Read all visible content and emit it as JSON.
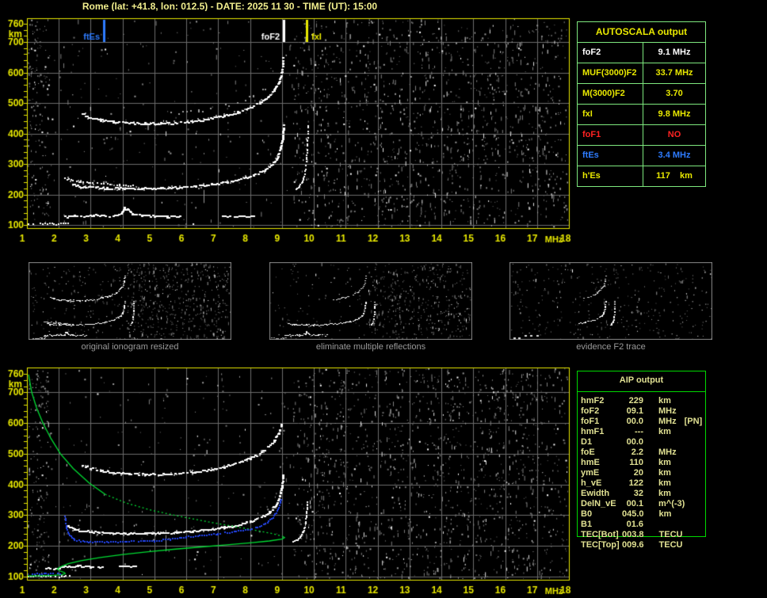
{
  "title": "Rome (lat: +41.8, lon: 012.5) - DATE: 2025 11 30 - TIME (UT): 15:00",
  "colors": {
    "accent_yellow": "#e8e800",
    "title_yellow": "#f2ef8e",
    "grid_gray": "#6c6c6c",
    "trace_white": "#ffffff",
    "trace_gray": "#9a9a9a",
    "profile_green": "#00dd33",
    "scaled_trace_blue": "#2244ee",
    "marker_blue": "#2e7cff",
    "table_border_light_green": "#7ee87e",
    "table_border_green": "#00d800",
    "aip_text": "#e0e092",
    "caption_gray": "#9a9a9a",
    "alert_red": "#ff2222"
  },
  "autoscala_table": {
    "title": "AUTOSCALA output",
    "rows": [
      {
        "label": "foF2",
        "value": "9.1 MHz",
        "color": "#ffffff"
      },
      {
        "label": "MUF(3000)F2",
        "value": "33.7 MHz",
        "color": "#e8e800"
      },
      {
        "label": "M(3000)F2",
        "value": "3.70",
        "color": "#e8e800"
      },
      {
        "label": "fxI",
        "value": "9.8 MHz",
        "color": "#e8e800"
      },
      {
        "label": "foF1",
        "value": "NO",
        "color": "#ff2222"
      },
      {
        "label": "ftEs",
        "value": "3.4 MHz",
        "color": "#2e7cff"
      },
      {
        "label": "h'Es",
        "value": "117    km",
        "color": "#e8e800"
      }
    ]
  },
  "aip_table": {
    "title": "AIP output",
    "rows": [
      {
        "label": "hmF2",
        "value": "229",
        "unit": "km",
        "note": ""
      },
      {
        "label": "foF2",
        "value": "09.1",
        "unit": "MHz",
        "note": ""
      },
      {
        "label": "foF1",
        "value": "00.0",
        "unit": "MHz",
        "note": "[PN]"
      },
      {
        "label": "hmF1",
        "value": "---",
        "unit": "km",
        "note": ""
      },
      {
        "label": "D1",
        "value": "00.0",
        "unit": "",
        "note": ""
      },
      {
        "label": "foE",
        "value": "2.2",
        "unit": "MHz",
        "note": ""
      },
      {
        "label": "hmE",
        "value": "110",
        "unit": "km",
        "note": ""
      },
      {
        "label": "ymE",
        "value": "20",
        "unit": "km",
        "note": ""
      },
      {
        "label": "h_vE",
        "value": "122",
        "unit": "km",
        "note": ""
      },
      {
        "label": "Ewidth",
        "value": "32",
        "unit": "km",
        "note": ""
      },
      {
        "label": "DelN_vE",
        "value": "00.1",
        "unit": "m^(-3)",
        "note": ""
      },
      {
        "label": "B0",
        "value": "045.0",
        "unit": "km",
        "note": ""
      },
      {
        "label": "B1",
        "value": "01.6",
        "unit": "",
        "note": ""
      },
      {
        "label": "TEC[Bot]",
        "value": "003.8",
        "unit": "TECU",
        "note": ""
      },
      {
        "label": "TEC[Top]",
        "value": "009.6",
        "unit": "TECU",
        "note": ""
      }
    ]
  },
  "thumbnails": [
    {
      "caption": "original ionogram resized"
    },
    {
      "caption": "eliminate multiple reflections"
    },
    {
      "caption": "evidence F2 trace"
    }
  ],
  "chart_data": {
    "type": "scatter",
    "xlabel": "MHz",
    "ylabel": "km",
    "xlim": [
      1,
      18
    ],
    "ylim": [
      100,
      760
    ],
    "grid": true,
    "x_ticks": [
      1,
      2,
      3,
      4,
      5,
      6,
      7,
      8,
      9,
      10,
      11,
      12,
      13,
      14,
      15,
      16,
      17,
      18
    ],
    "y_ticks": [
      760,
      700,
      600,
      500,
      400,
      300,
      200,
      100
    ],
    "top_plot": {
      "markers": [
        {
          "name": "ftEs",
          "freq": 3.4,
          "color": "#2e7cff",
          "label_side": "left"
        },
        {
          "name": "foF2",
          "freq": 9.05,
          "color": "#ffffff",
          "label_side": "left"
        },
        {
          "name": "fxI",
          "freq": 9.78,
          "color": "#e8e800",
          "label_side": "right"
        }
      ],
      "traces": {
        "f2_upper": [
          [
            2.2,
            252
          ],
          [
            2.45,
            246
          ],
          [
            2.7,
            241
          ],
          [
            3.0,
            237
          ],
          [
            3.4,
            234
          ],
          [
            3.9,
            231
          ],
          [
            4.4,
            229
          ]
        ],
        "f2_main": [
          [
            2.45,
            230
          ],
          [
            2.7,
            225
          ],
          [
            3.0,
            222
          ],
          [
            3.5,
            220
          ],
          [
            4.0,
            219
          ],
          [
            4.6,
            219
          ],
          [
            5.2,
            220
          ],
          [
            5.8,
            222
          ],
          [
            6.3,
            226
          ],
          [
            6.8,
            232
          ],
          [
            7.3,
            240
          ],
          [
            7.7,
            250
          ],
          [
            8.1,
            263
          ],
          [
            8.45,
            279
          ],
          [
            8.7,
            298
          ],
          [
            8.85,
            320
          ],
          [
            8.95,
            348
          ],
          [
            9.02,
            382
          ],
          [
            9.05,
            425
          ]
        ],
        "hop2": [
          [
            2.75,
            462
          ],
          [
            3.0,
            452
          ],
          [
            3.3,
            444
          ],
          [
            3.7,
            438
          ],
          [
            4.2,
            434
          ],
          [
            4.7,
            432
          ],
          [
            5.2,
            432
          ],
          [
            5.7,
            434
          ],
          [
            6.2,
            439
          ],
          [
            6.7,
            446
          ],
          [
            7.2,
            457
          ],
          [
            7.6,
            469
          ],
          [
            8.0,
            484
          ],
          [
            8.3,
            500
          ],
          [
            8.55,
            519
          ],
          [
            8.75,
            541
          ],
          [
            8.9,
            566
          ],
          [
            9.0,
            602
          ],
          [
            9.04,
            645
          ]
        ],
        "hop2_upper_dots": [
          [
            5.4,
            464
          ],
          [
            5.9,
            468
          ],
          [
            6.4,
            474
          ],
          [
            6.9,
            483
          ],
          [
            7.35,
            494
          ],
          [
            7.75,
            508
          ],
          [
            8.1,
            524
          ],
          [
            8.4,
            543
          ],
          [
            8.65,
            562
          ]
        ],
        "es": [
          [
            2.2,
            126
          ],
          [
            2.5,
            129
          ],
          [
            2.8,
            127
          ],
          [
            3.1,
            131
          ],
          [
            3.4,
            128
          ],
          [
            3.7,
            130
          ],
          [
            3.95,
            136
          ],
          [
            4.05,
            155
          ],
          [
            4.15,
            150
          ],
          [
            4.3,
            136
          ],
          [
            4.6,
            130
          ],
          [
            5.0,
            128
          ],
          [
            5.4,
            127
          ],
          [
            5.8,
            127
          ]
        ],
        "es_dash": [
          [
            7.15,
            128
          ],
          [
            8.1,
            128
          ]
        ],
        "es_low": [
          [
            1.05,
            104
          ],
          [
            1.5,
            103
          ],
          [
            2.0,
            103
          ],
          [
            2.3,
            105
          ]
        ],
        "xmode": [
          [
            9.45,
            215
          ],
          [
            9.55,
            225
          ],
          [
            9.65,
            242
          ],
          [
            9.72,
            265
          ],
          [
            9.76,
            295
          ],
          [
            9.79,
            335
          ],
          [
            9.81,
            380
          ],
          [
            9.82,
            425
          ]
        ],
        "spur": {
          "freq": 6.55,
          "h_from": 215,
          "h_to": 172
        }
      }
    },
    "bottom_plot": {
      "traces": {
        "f2_main": [
          [
            2.3,
            264
          ],
          [
            2.5,
            253
          ],
          [
            2.8,
            247
          ],
          [
            3.2,
            243
          ],
          [
            3.7,
            241
          ],
          [
            4.2,
            240
          ],
          [
            4.7,
            240
          ],
          [
            5.2,
            241
          ],
          [
            5.7,
            243
          ],
          [
            6.2,
            247
          ],
          [
            6.7,
            252
          ],
          [
            7.2,
            259
          ],
          [
            7.6,
            267
          ],
          [
            8.0,
            278
          ],
          [
            8.35,
            292
          ],
          [
            8.6,
            308
          ],
          [
            8.8,
            331
          ],
          [
            8.92,
            358
          ],
          [
            9.0,
            392
          ],
          [
            9.04,
            428
          ]
        ],
        "hop2": [
          [
            2.75,
            462
          ],
          [
            3.0,
            452
          ],
          [
            3.3,
            444
          ],
          [
            3.7,
            438
          ],
          [
            4.2,
            434
          ],
          [
            4.7,
            432
          ],
          [
            5.2,
            432
          ],
          [
            5.7,
            434
          ],
          [
            6.2,
            439
          ],
          [
            6.7,
            446
          ],
          [
            7.2,
            457
          ],
          [
            7.6,
            469
          ],
          [
            8.0,
            484
          ],
          [
            8.3,
            500
          ],
          [
            8.55,
            519
          ],
          [
            8.75,
            541
          ],
          [
            8.9,
            566
          ],
          [
            9.0,
            602
          ]
        ],
        "es": [
          [
            1.6,
            128
          ],
          [
            1.9,
            125
          ],
          [
            2.2,
            131
          ],
          [
            2.6,
            134
          ],
          [
            3.0,
            131
          ],
          [
            3.35,
            129
          ]
        ],
        "es_dash": [
          [
            3.9,
            133
          ],
          [
            4.4,
            133
          ]
        ],
        "es_low": [
          [
            1.05,
            100
          ],
          [
            1.6,
            101
          ],
          [
            2.1,
            100
          ],
          [
            2.35,
            103
          ]
        ],
        "xmode": [
          [
            9.35,
            212
          ],
          [
            9.45,
            217
          ],
          [
            9.58,
            227
          ],
          [
            9.68,
            246
          ],
          [
            9.74,
            273
          ],
          [
            9.78,
            306
          ],
          [
            9.8,
            342
          ]
        ],
        "spur": {
          "freq": 5.35,
          "h_from": 235,
          "h_to": 182
        }
      },
      "scaled_trace_blue": [
        [
          2.2,
          296
        ],
        [
          2.25,
          258
        ],
        [
          2.3,
          244
        ],
        [
          2.38,
          230
        ],
        [
          2.5,
          219
        ],
        [
          2.7,
          215
        ],
        [
          3.0,
          213
        ],
        [
          3.5,
          213
        ],
        [
          4.0,
          213
        ],
        [
          4.5,
          214
        ],
        [
          5.0,
          216
        ],
        [
          5.5,
          221
        ],
        [
          6.0,
          228
        ],
        [
          6.5,
          234
        ],
        [
          7.0,
          239
        ],
        [
          7.5,
          246
        ],
        [
          8.0,
          254
        ],
        [
          8.3,
          263
        ],
        [
          8.55,
          276
        ],
        [
          8.72,
          292
        ],
        [
          8.85,
          312
        ],
        [
          8.93,
          332
        ],
        [
          8.98,
          350
        ]
      ],
      "scaled_es_blue": [
        [
          1.02,
          108
        ],
        [
          2.05,
          110
        ]
      ],
      "profile_green": {
        "topside_solid": [
          [
            1.05,
            758
          ],
          [
            1.15,
            700
          ],
          [
            1.3,
            650
          ],
          [
            1.5,
            600
          ],
          [
            1.75,
            550
          ],
          [
            2.05,
            500
          ],
          [
            2.45,
            452
          ],
          [
            2.95,
            405
          ],
          [
            3.45,
            368
          ]
        ],
        "topside_dotted": [
          [
            3.45,
            368
          ],
          [
            4.1,
            340
          ],
          [
            4.9,
            316
          ],
          [
            5.8,
            296
          ],
          [
            6.8,
            276
          ],
          [
            7.9,
            256
          ],
          [
            8.7,
            240
          ],
          [
            9.02,
            231
          ]
        ],
        "bottomside_solid": [
          [
            9.02,
            231
          ],
          [
            9.08,
            227
          ],
          [
            9.0,
            222
          ],
          [
            8.6,
            216
          ],
          [
            8.0,
            210
          ],
          [
            7.2,
            203
          ],
          [
            6.4,
            196
          ],
          [
            5.6,
            189
          ],
          [
            4.8,
            181
          ],
          [
            4.0,
            172
          ],
          [
            3.3,
            162
          ],
          [
            2.7,
            152
          ],
          [
            2.3,
            142
          ],
          [
            2.1,
            134
          ],
          [
            2.0,
            128
          ],
          [
            1.95,
            124
          ],
          [
            2.05,
            118
          ],
          [
            2.18,
            113
          ],
          [
            2.2,
            110
          ],
          [
            2.1,
            106
          ],
          [
            1.85,
            104
          ],
          [
            1.5,
            103
          ],
          [
            1.2,
            102
          ],
          [
            1.03,
            102
          ]
        ]
      }
    }
  }
}
